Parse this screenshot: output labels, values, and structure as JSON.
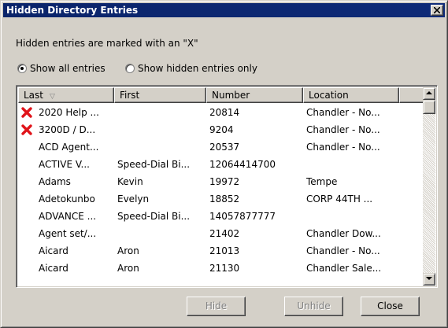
{
  "window": {
    "title": "Hidden Directory Entries"
  },
  "hint": "Hidden entries are marked with an \"X\"",
  "filter": {
    "options": [
      {
        "label": "Show all entries",
        "selected": true
      },
      {
        "label": "Show hidden entries only",
        "selected": false
      }
    ]
  },
  "table": {
    "columns": [
      "Last",
      "First",
      "Number",
      "Location"
    ],
    "sort_indicator": "▽",
    "rows": [
      {
        "hidden": true,
        "last": "2020 Help ...",
        "first": "",
        "number": "20814",
        "location": "Chandler - No..."
      },
      {
        "hidden": true,
        "last": "3200D / D...",
        "first": "",
        "number": "9204",
        "location": "Chandler - No..."
      },
      {
        "hidden": false,
        "last": "ACD Agent...",
        "first": "",
        "number": "20537",
        "location": "Chandler - No..."
      },
      {
        "hidden": false,
        "last": "ACTIVE V...",
        "first": "Speed-Dial Bi...",
        "number": "12064414700",
        "location": ""
      },
      {
        "hidden": false,
        "last": "Adams",
        "first": "Kevin",
        "number": "19972",
        "location": "Tempe"
      },
      {
        "hidden": false,
        "last": "Adetokunbo",
        "first": "Evelyn",
        "number": "18852",
        "location": "CORP 44TH ..."
      },
      {
        "hidden": false,
        "last": "ADVANCE ...",
        "first": "Speed-Dial Bi...",
        "number": "14057877777",
        "location": ""
      },
      {
        "hidden": false,
        "last": "Agent set/...",
        "first": "",
        "number": "21402",
        "location": "Chandler Dow..."
      },
      {
        "hidden": false,
        "last": "Aicard",
        "first": "Aron",
        "number": "21013",
        "location": "Chandler - No..."
      },
      {
        "hidden": false,
        "last": "Aicard",
        "first": "Aron",
        "number": "21130",
        "location": "Chandler Sale..."
      }
    ]
  },
  "buttons": {
    "hide": "Hide",
    "unhide": "Unhide",
    "close": "Close"
  },
  "colors": {
    "titlebar": "#0a246a",
    "hidden_mark": "#e0141a",
    "face": "#d4d0c8"
  }
}
